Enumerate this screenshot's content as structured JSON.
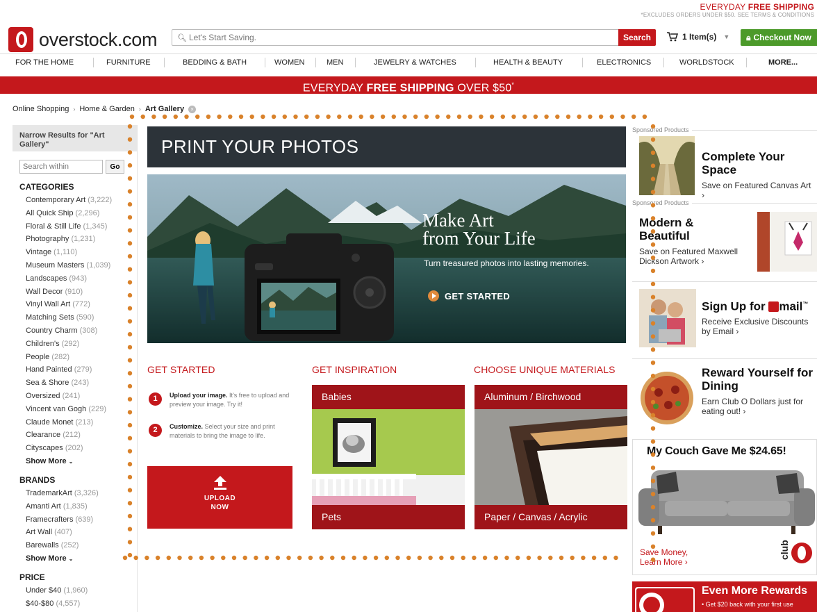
{
  "top_promo": {
    "main_prefix": "EVERYDAY ",
    "main_bold": "FREE SHIPPING",
    "sub": "*EXCLUDES ORDERS UNDER $50. SEE TERMS & CONDITIONS"
  },
  "header": {
    "logo_text": "overstock.com",
    "search_placeholder": "Let's Start Saving.",
    "search_button": "Search",
    "cart_label": "1 Item(s)",
    "checkout_label": "Checkout Now"
  },
  "nav": [
    "FOR THE HOME",
    "FURNITURE",
    "BEDDING & BATH",
    "WOMEN",
    "MEN",
    "JEWELRY & WATCHES",
    "HEALTH & BEAUTY",
    "ELECTRONICS",
    "WORLDSTOCK",
    "MORE..."
  ],
  "banner": {
    "prefix": "EVERYDAY ",
    "bold": "FREE SHIPPING",
    "suffix": " OVER $50",
    "mark": "*"
  },
  "breadcrumb": {
    "items": [
      "Online Shopping",
      "Home & Garden"
    ],
    "current": "Art Gallery",
    "close_glyph": "×"
  },
  "sidebar": {
    "narrow_title": "Narrow Results for \"Art Gallery\"",
    "search_placeholder": "Search within",
    "go": "Go",
    "categories_title": "CATEGORIES",
    "categories": [
      {
        "name": "Contemporary Art",
        "count": "(3,222)"
      },
      {
        "name": "All Quick Ship",
        "count": "(2,296)"
      },
      {
        "name": "Floral & Still Life",
        "count": "(1,345)"
      },
      {
        "name": "Photography",
        "count": "(1,231)"
      },
      {
        "name": "Vintage",
        "count": "(1,110)"
      },
      {
        "name": "Museum Masters",
        "count": "(1,039)"
      },
      {
        "name": "Landscapes",
        "count": "(943)"
      },
      {
        "name": "Wall Decor",
        "count": "(910)"
      },
      {
        "name": "Vinyl Wall Art",
        "count": "(772)"
      },
      {
        "name": "Matching Sets",
        "count": "(590)"
      },
      {
        "name": "Country Charm",
        "count": "(308)"
      },
      {
        "name": "Children's",
        "count": "(292)"
      },
      {
        "name": "People",
        "count": "(282)"
      },
      {
        "name": "Hand Painted",
        "count": "(279)"
      },
      {
        "name": "Sea & Shore",
        "count": "(243)"
      },
      {
        "name": "Oversized",
        "count": "(241)"
      },
      {
        "name": "Vincent van Gogh",
        "count": "(229)"
      },
      {
        "name": "Claude Monet",
        "count": "(213)"
      },
      {
        "name": "Clearance",
        "count": "(212)"
      },
      {
        "name": "Cityscapes",
        "count": "(202)"
      }
    ],
    "show_more": "Show More",
    "brands_title": "BRANDS",
    "brands": [
      {
        "name": "TrademarkArt",
        "count": "(3,326)"
      },
      {
        "name": "Amanti Art",
        "count": "(1,835)"
      },
      {
        "name": "Framecrafters",
        "count": "(639)"
      },
      {
        "name": "Art Wall",
        "count": "(407)"
      },
      {
        "name": "Barewalls",
        "count": "(252)"
      }
    ],
    "price_title": "PRICE",
    "prices": [
      {
        "name": "Under $40",
        "count": "(1,960)"
      },
      {
        "name": "$40-$80",
        "count": "(4,557)"
      }
    ]
  },
  "main": {
    "title": "PRINT YOUR PHOTOS",
    "hero_line1": "Make Art",
    "hero_line2": "from Your Life",
    "hero_sub": "Turn treasured photos into lasting memories.",
    "hero_cta": "GET STARTED",
    "sections": [
      "GET STARTED",
      "GET INSPIRATION",
      "CHOOSE UNIQUE MATERIALS"
    ],
    "steps": [
      {
        "num": "1",
        "bold": "Upload your image.",
        "text": " It's free to upload and preview your image. Try it!"
      },
      {
        "num": "2",
        "bold": "Customize.",
        "text": " Select your size and print materials to bring the image to life."
      }
    ],
    "upload_line1": "UPLOAD",
    "upload_line2": "NOW",
    "inspiration": {
      "top": "Babies",
      "bottom": "Pets"
    },
    "materials": {
      "top": "Aluminum / Birchwood",
      "bottom": "Paper / Canvas / Acrylic"
    }
  },
  "right": {
    "sponsored": "Sponsored Products",
    "promo1": {
      "title": "Complete Your Space",
      "text": "Save on Featured Canvas Art ›"
    },
    "promo2": {
      "title": "Modern & Beautiful",
      "text": "Save on Featured Maxwell Dickson Artwork ›"
    },
    "promo3": {
      "title": "Sign Up for",
      "brand": "mail",
      "tm": "™",
      "text": "Receive Exclusive Discounts by Email ›"
    },
    "promo4": {
      "title": "Reward Yourself for Dining",
      "text": "Earn Club O Dollars just for eating out! ›"
    },
    "couch": {
      "title": "My Couch Gave Me $24.65!",
      "cta1": "Save Money,",
      "cta2": "Learn More ›",
      "club": "club"
    },
    "rewards": {
      "title": "Even More Rewards",
      "text": "• Get $20 back with your first use"
    }
  },
  "colors": {
    "brand_red": "#c4181c",
    "dark_red": "#9f1419",
    "checkout_green": "#4c9a2a",
    "annotation_orange": "#d9822b"
  }
}
